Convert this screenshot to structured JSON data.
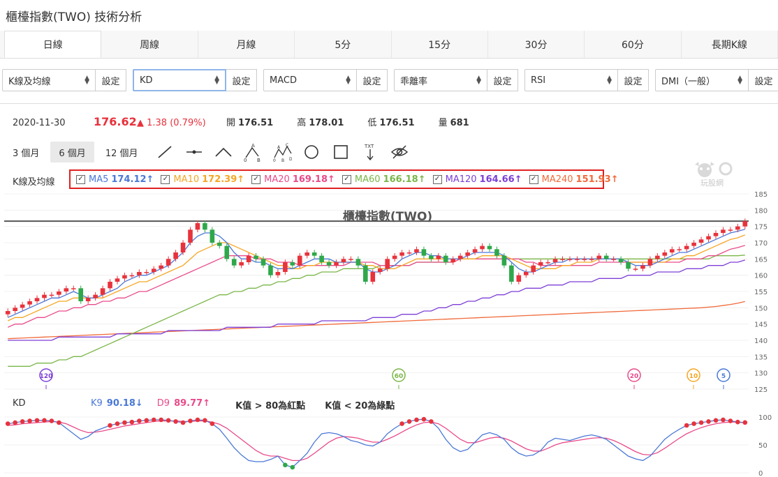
{
  "page_title": "櫃檯指數(TWO) 技術分析",
  "tabs": [
    "日線",
    "周線",
    "月線",
    "5分",
    "15分",
    "30分",
    "60分",
    "長期K線"
  ],
  "selectors": [
    {
      "value": "K線及均線",
      "button": "設定"
    },
    {
      "value": "KD",
      "button": "設定"
    },
    {
      "value": "MACD",
      "button": "設定"
    },
    {
      "value": "乖離率",
      "button": "設定"
    },
    {
      "value": "RSI",
      "button": "設定"
    },
    {
      "value": "DMI（一般）",
      "button": "設定"
    }
  ],
  "quote": {
    "date": "2020-11-30",
    "price": "176.62",
    "change": "▲ 1.38 (0.79%)",
    "open_label": "開",
    "open": "176.51",
    "high_label": "高",
    "high": "178.01",
    "low_label": "低",
    "low": "176.51",
    "vol_label": "量",
    "vol": "681"
  },
  "ranges": [
    "3 個月",
    "6 個月",
    "12 個月"
  ],
  "tool_icons": [
    "trend-line-icon",
    "horizontal-line-icon",
    "angle-line-icon",
    "abc-pattern-icon",
    "abcd-pattern-icon",
    "circle-icon",
    "rectangle-icon",
    "text-icon",
    "hide-icon"
  ],
  "ma_section_label": "K線及均線",
  "ma_items": [
    {
      "label": "MA5",
      "value": "174.12↑",
      "color": "#4a78d6"
    },
    {
      "label": "MA10",
      "value": "172.39↑",
      "color": "#f5a623"
    },
    {
      "label": "MA20",
      "value": "169.18↑",
      "color": "#e94a8a"
    },
    {
      "label": "MA60",
      "value": "166.18↑",
      "color": "#7ab648"
    },
    {
      "label": "MA120",
      "value": "164.66↑",
      "color": "#7d3fd6"
    },
    {
      "label": "MA240",
      "value": "151.93↑",
      "color": "#f06a3a"
    }
  ],
  "logo_text": "玩股網",
  "chart_data": {
    "type": "candlestick",
    "title": "櫃檯指數(TWO)",
    "y_ticks": [
      185,
      180,
      175,
      170,
      165,
      160,
      155,
      150,
      145,
      140,
      135,
      130,
      125
    ],
    "ylim": [
      125,
      185
    ],
    "reference_line": 176.62,
    "markers": [
      {
        "label": "120",
        "color": "#7d3fd6"
      },
      {
        "label": "60",
        "color": "#7ab648"
      },
      {
        "label": "20",
        "color": "#e94a8a"
      },
      {
        "label": "10",
        "color": "#f5a623"
      },
      {
        "label": "5",
        "color": "#4a78d6"
      }
    ],
    "closes": [
      149,
      150,
      151,
      152,
      153,
      154,
      154,
      155,
      156,
      156,
      152,
      153,
      154,
      156,
      158,
      159,
      160,
      160,
      161,
      161,
      162,
      163,
      165,
      167,
      170,
      174,
      176,
      174,
      170,
      169,
      165,
      163,
      164,
      166,
      165,
      163,
      160,
      161,
      164,
      163,
      166,
      167,
      166,
      164,
      163,
      164,
      165,
      165,
      163,
      158,
      161,
      162,
      165,
      166,
      167,
      167,
      168,
      166,
      165,
      166,
      164,
      165,
      166,
      167,
      168,
      169,
      168,
      166,
      163,
      158,
      160,
      161,
      163,
      164,
      164,
      165,
      165,
      165,
      165,
      165,
      165,
      166,
      165,
      165,
      164,
      162,
      162,
      163,
      165,
      166,
      167,
      168,
      168,
      169,
      170,
      171,
      172,
      173,
      174,
      174,
      175,
      176.62
    ],
    "ma5": [
      147,
      148,
      149,
      150,
      151,
      152,
      153,
      153,
      154,
      155,
      154,
      153,
      153,
      154,
      155,
      156,
      158,
      159,
      160,
      160,
      161,
      162,
      163,
      165,
      167,
      170,
      172,
      173,
      173,
      172,
      170,
      167,
      165,
      165,
      164,
      164,
      163,
      162,
      162,
      162,
      163,
      164,
      165,
      165,
      165,
      164,
      164,
      164,
      164,
      162,
      161,
      161,
      162,
      163,
      165,
      166,
      167,
      167,
      166,
      166,
      165,
      165,
      165,
      166,
      167,
      167,
      167,
      167,
      166,
      164,
      162,
      161,
      161,
      162,
      163,
      164,
      164,
      165,
      165,
      165,
      165,
      165,
      165,
      165,
      165,
      164,
      163,
      163,
      163,
      164,
      165,
      166,
      167,
      167,
      168,
      169,
      170,
      171,
      172,
      173,
      173.5,
      174.12
    ],
    "ma10": [
      146,
      147,
      147,
      148,
      149,
      150,
      151,
      152,
      152,
      153,
      153,
      153,
      153,
      153,
      154,
      155,
      156,
      157,
      158,
      158,
      159,
      160,
      161,
      162,
      163,
      165,
      167,
      168,
      169,
      170,
      170,
      169,
      168,
      167,
      166,
      165,
      164,
      163,
      163,
      162,
      162,
      163,
      163,
      164,
      164,
      164,
      164,
      164,
      164,
      163,
      163,
      162,
      162,
      162,
      163,
      164,
      165,
      165,
      165,
      165,
      165,
      165,
      165,
      165,
      165,
      166,
      166,
      166,
      166,
      165,
      164,
      163,
      162,
      162,
      162,
      162,
      163,
      163,
      164,
      164,
      164,
      165,
      165,
      165,
      165,
      164,
      164,
      164,
      164,
      164,
      164,
      165,
      165,
      166,
      166,
      167,
      168,
      169,
      170,
      171,
      171.5,
      172.39
    ],
    "ma20": [
      144,
      145,
      145,
      146,
      147,
      147,
      148,
      149,
      149,
      150,
      150,
      151,
      151,
      152,
      152,
      153,
      153,
      154,
      155,
      155,
      156,
      157,
      158,
      159,
      160,
      161,
      162,
      163,
      164,
      165,
      166,
      166,
      166,
      166,
      165,
      165,
      165,
      164,
      164,
      164,
      163,
      163,
      163,
      163,
      163,
      163,
      163,
      164,
      164,
      164,
      164,
      163,
      163,
      163,
      163,
      163,
      164,
      164,
      164,
      164,
      164,
      164,
      165,
      165,
      165,
      165,
      165,
      165,
      165,
      165,
      165,
      164,
      164,
      163,
      163,
      163,
      163,
      163,
      163,
      163,
      163,
      164,
      164,
      164,
      164,
      164,
      164,
      164,
      164,
      164,
      164,
      164,
      164,
      165,
      165,
      165,
      166,
      166,
      167,
      168,
      168.5,
      169.18
    ],
    "ma60": [
      132,
      132,
      132,
      132,
      133,
      133,
      133,
      134,
      134,
      135,
      135,
      136,
      137,
      138,
      139,
      140,
      141,
      142,
      143,
      144,
      145,
      146,
      147,
      148,
      149,
      150,
      151,
      152,
      153,
      154,
      154,
      155,
      155,
      156,
      156,
      157,
      157,
      158,
      158,
      159,
      159,
      160,
      160,
      161,
      161,
      161,
      162,
      162,
      162,
      162,
      162,
      163,
      163,
      163,
      163,
      163,
      164,
      164,
      164,
      164,
      164,
      164,
      165,
      165,
      165,
      165,
      165,
      165,
      165,
      165,
      165,
      165,
      165,
      165,
      165,
      165,
      165,
      165,
      165,
      165,
      165,
      165,
      165,
      165,
      165,
      165,
      165,
      165,
      165,
      165,
      165,
      165,
      165,
      165,
      165,
      165,
      165,
      166,
      166,
      166,
      166,
      166.18
    ],
    "ma120": [
      140,
      140,
      140,
      140,
      140,
      140,
      140,
      141,
      141,
      141,
      141,
      141,
      141,
      141,
      141,
      142,
      142,
      142,
      142,
      142,
      142,
      142,
      143,
      143,
      143,
      143,
      143,
      143,
      143,
      143,
      144,
      144,
      144,
      144,
      144,
      144,
      144,
      145,
      145,
      145,
      145,
      145,
      145,
      146,
      146,
      146,
      146,
      146,
      146,
      146,
      147,
      147,
      147,
      147,
      148,
      148,
      148,
      149,
      149,
      150,
      150,
      151,
      151,
      152,
      152,
      153,
      153,
      154,
      154,
      155,
      155,
      156,
      156,
      156,
      157,
      157,
      157,
      158,
      158,
      158,
      158,
      159,
      159,
      159,
      159,
      160,
      160,
      160,
      160,
      161,
      161,
      161,
      161,
      162,
      162,
      162,
      163,
      163,
      163,
      164,
      164,
      164.66
    ],
    "ma240": [
      140.5,
      140.6,
      140.7,
      140.8,
      140.9,
      141,
      141.1,
      141.2,
      141.3,
      141.4,
      141.5,
      141.6,
      141.7,
      141.8,
      141.9,
      142,
      142.1,
      142.2,
      142.3,
      142.4,
      142.5,
      142.6,
      142.7,
      142.8,
      142.9,
      143,
      143.1,
      143.2,
      143.3,
      143.4,
      143.5,
      143.6,
      143.7,
      143.8,
      143.9,
      144,
      144.1,
      144.2,
      144.3,
      144.4,
      144.5,
      144.6,
      144.7,
      144.8,
      144.9,
      145,
      145.1,
      145.2,
      145.3,
      145.4,
      145.5,
      145.6,
      145.7,
      145.8,
      145.9,
      146,
      146.1,
      146.2,
      146.3,
      146.4,
      146.5,
      146.6,
      146.7,
      146.8,
      146.9,
      147,
      147.1,
      147.2,
      147.3,
      147.4,
      147.5,
      147.6,
      147.7,
      147.8,
      147.9,
      148,
      148.1,
      148.2,
      148.3,
      148.4,
      148.5,
      148.6,
      148.7,
      148.8,
      148.9,
      149,
      149.1,
      149.2,
      149.3,
      149.4,
      149.5,
      149.6,
      149.7,
      149.8,
      149.9,
      150,
      150.2,
      150.4,
      150.7,
      151,
      151.4,
      151.93
    ]
  },
  "kd": {
    "label": "KD",
    "k_label": "K9",
    "k_value": "90.18↓",
    "d_label": "D9",
    "d_value": "89.77↑",
    "note1": "K值 > 80為紅點",
    "note2": "K值 < 20為綠點",
    "y_ticks": [
      100,
      50,
      0
    ],
    "k": [
      88,
      90,
      92,
      93,
      94,
      94,
      93,
      90,
      80,
      70,
      60,
      65,
      75,
      80,
      85,
      88,
      90,
      91,
      93,
      94,
      95,
      95,
      94,
      92,
      90,
      93,
      95,
      94,
      88,
      78,
      62,
      45,
      32,
      22,
      20,
      20,
      24,
      30,
      14,
      10,
      22,
      35,
      55,
      70,
      72,
      70,
      65,
      58,
      55,
      50,
      48,
      55,
      70,
      80,
      88,
      92,
      95,
      96,
      92,
      80,
      60,
      45,
      38,
      42,
      55,
      68,
      72,
      68,
      60,
      45,
      35,
      30,
      32,
      40,
      55,
      62,
      60,
      58,
      62,
      66,
      68,
      65,
      60,
      50,
      40,
      30,
      25,
      22,
      30,
      45,
      60,
      70,
      78,
      85,
      88,
      90,
      92,
      94,
      95,
      93,
      91,
      90.18
    ],
    "d": [
      85,
      86,
      88,
      89,
      90,
      91,
      92,
      91,
      88,
      82,
      76,
      72,
      73,
      75,
      78,
      81,
      84,
      86,
      88,
      90,
      92,
      93,
      93,
      93,
      92,
      92,
      93,
      93,
      91,
      87,
      80,
      70,
      60,
      50,
      40,
      33,
      30,
      30,
      26,
      22,
      22,
      26,
      35,
      45,
      55,
      62,
      65,
      64,
      62,
      58,
      55,
      55,
      60,
      66,
      73,
      80,
      86,
      90,
      91,
      88,
      80,
      70,
      60,
      54,
      54,
      58,
      62,
      64,
      62,
      57,
      50,
      43,
      39,
      39,
      44,
      50,
      54,
      56,
      58,
      60,
      62,
      63,
      62,
      58,
      52,
      45,
      38,
      33,
      32,
      36,
      44,
      53,
      62,
      70,
      76,
      81,
      85,
      88,
      90,
      91,
      91,
      89.77
    ]
  }
}
